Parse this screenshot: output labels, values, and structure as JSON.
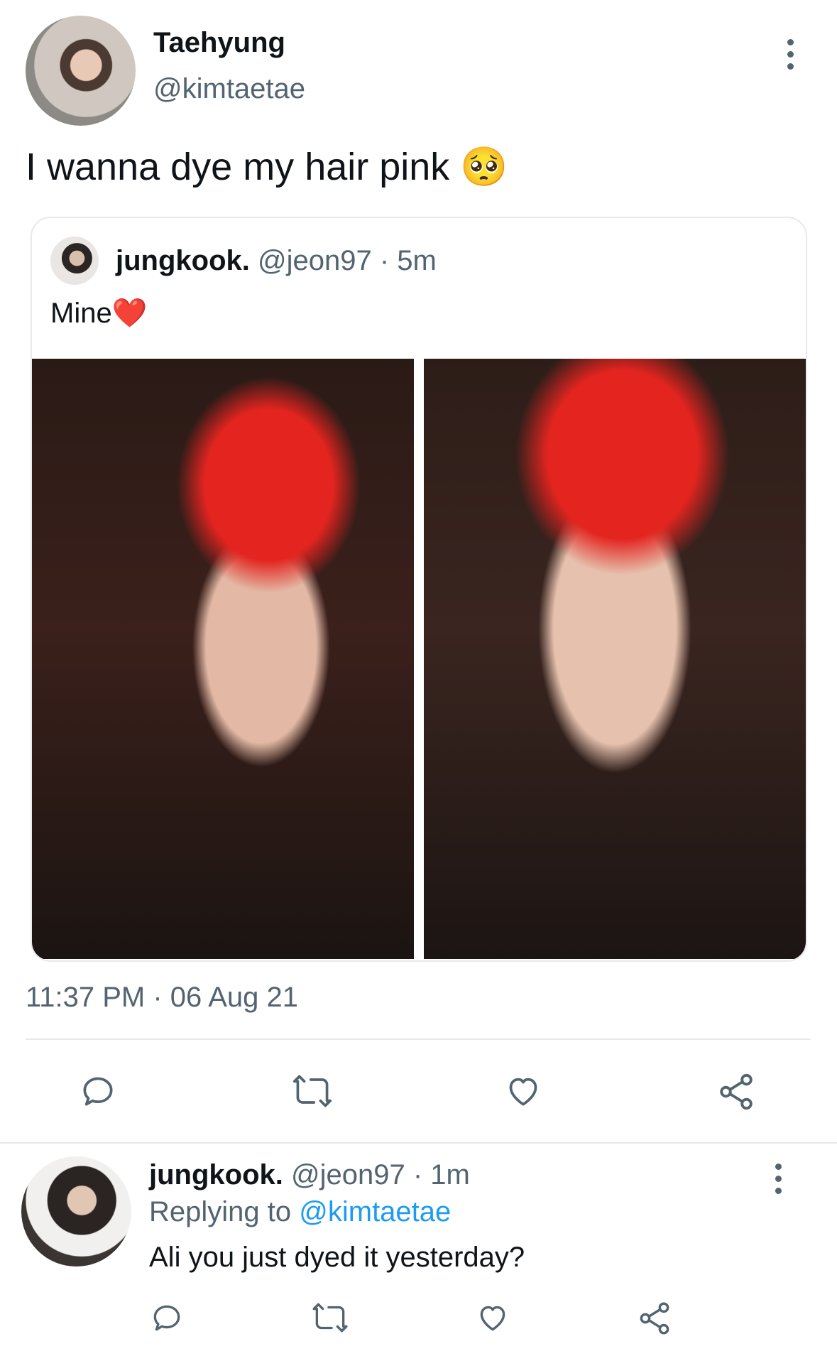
{
  "main_tweet": {
    "author_name": "Taehyung",
    "author_handle": "@kimtaetae",
    "text": "I wanna dye my hair pink",
    "emoji": "🥺",
    "timestamp": "11:37 PM · 06 Aug 21"
  },
  "quoted_tweet": {
    "author_name": "jungkook.",
    "author_handle": "@jeon97",
    "time": "· 5m",
    "text": "Mine",
    "emoji": "❤️"
  },
  "actions": [
    "reply-icon",
    "retweet-icon",
    "like-icon",
    "share-icon"
  ],
  "reply": {
    "author_name": "jungkook.",
    "author_handle": "@jeon97",
    "time": "· 1m",
    "replying_prefix": "Replying to",
    "replying_to": "@kimtaetae",
    "text": "Ali you just dyed it yesterday?"
  },
  "colors": {
    "accent": "#1d9bf0",
    "muted": "#536471",
    "border": "#e7e9eb"
  }
}
